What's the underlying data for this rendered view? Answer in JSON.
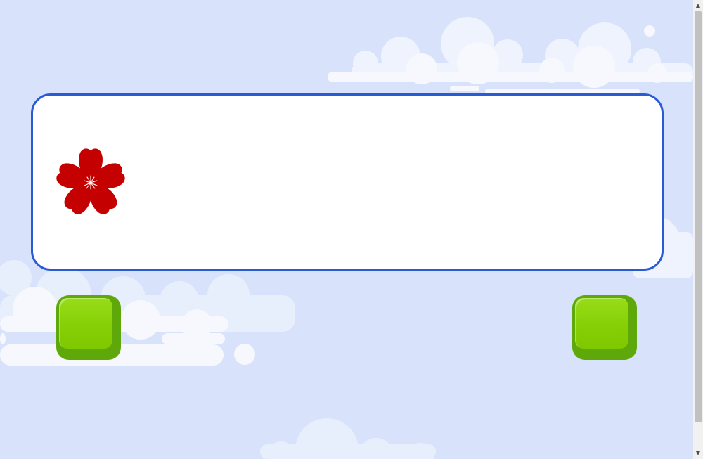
{
  "colors": {
    "background": "#d8e3fb",
    "card_border": "#2a5bd7",
    "flower": "#c40000",
    "button_green": "#86cf06",
    "button_shadow": "#5ea80a"
  },
  "card": {
    "icon": "red-flower-icon"
  },
  "buttons": {
    "left": {
      "icon": "green-square-button"
    },
    "right": {
      "icon": "green-square-button"
    }
  },
  "scrollbar": {
    "up_arrow": "▲",
    "down_arrow": "▼"
  }
}
